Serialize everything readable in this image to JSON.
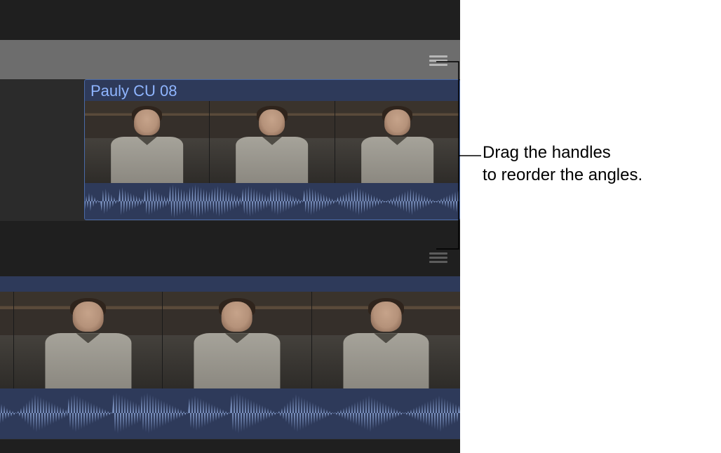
{
  "clip1": {
    "title": "Pauly CU 08"
  },
  "annotation": {
    "line1": "Drag the handles",
    "line2": "to reorder the angles."
  },
  "icons": {
    "drag_handle_top": "drag-handle-icon",
    "drag_handle_bottom": "drag-handle-icon"
  }
}
